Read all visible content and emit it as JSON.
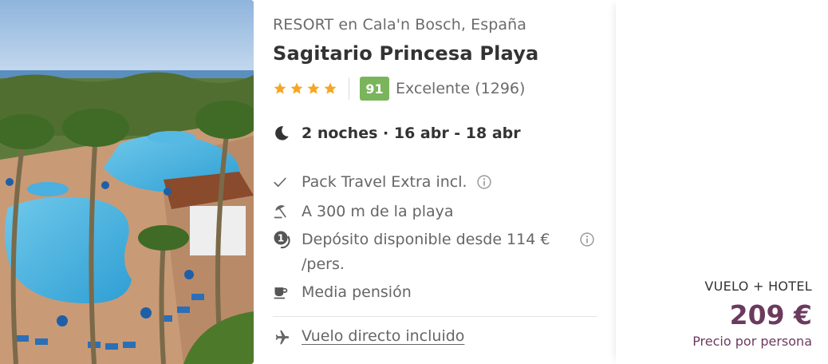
{
  "hotel": {
    "location_line": "RESORT en Cala'n Bosch, España",
    "name": "Sagitario Princesa Playa",
    "stars": 4,
    "score": "91",
    "rating_text": "Excelente (1296)"
  },
  "stay": {
    "dates": "2 noches · 16 abr - 18 abr"
  },
  "features": [
    {
      "icon": "check-icon",
      "label": "Pack Travel Extra incl."
    },
    {
      "icon": "beach-umbrella-icon",
      "label": "A 300 m de la playa"
    },
    {
      "icon": "deposit-icon",
      "label": "Depósito disponible desde 114 € /pers."
    },
    {
      "icon": "coffee-cup-icon",
      "label": "Media pensión"
    }
  ],
  "flight": {
    "label": "Vuelo directo incluido"
  },
  "price": {
    "pack_type": "VUELO + HOTEL",
    "amount": "209 €",
    "note": "Precio por persona"
  },
  "colors": {
    "price": "#6c3a5e",
    "score_badge": "#7ab55c",
    "stars": "#f5a623"
  }
}
